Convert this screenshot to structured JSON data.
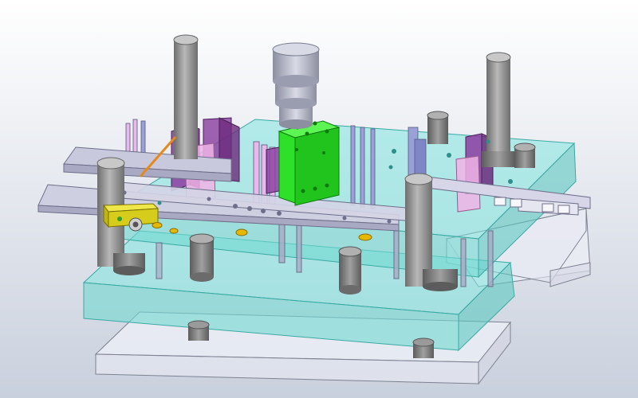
{
  "scene": {
    "kind": "3D CAD model of a progressive stamping die assembly",
    "background": {
      "top": "#ffffff",
      "bottom": "#c9d0dd"
    },
    "colors": {
      "die_plate": "#7fe6df",
      "die_plate_edge": "#3aa9a3",
      "base_block": "#e6e8f2",
      "base_edge": "#7d8292",
      "guide_pillar": "#9a9a9a",
      "guide_bushing": "#7c7c7c",
      "strip": "#c9c9de",
      "strip_edge": "#6e6e8a",
      "punch_block": "#2fe02a",
      "punch_block_dark": "#16a614",
      "purple_part": "#8a3ca0",
      "pink_part": "#f0b4e6",
      "yellow_part": "#d6cc1c",
      "orange_part": "#e48a1c",
      "blue_pin": "#9aa0d8"
    },
    "parts": [
      {
        "id": "guide-pillar",
        "count": 4
      },
      {
        "id": "punch-holder",
        "count": 1
      },
      {
        "id": "strip-material",
        "count": 1
      },
      {
        "id": "punch-block",
        "count": 1
      },
      {
        "id": "upper-die-plate",
        "count": 1
      },
      {
        "id": "lower-base",
        "count": 1
      },
      {
        "id": "sensor-module",
        "count": 1
      }
    ]
  }
}
